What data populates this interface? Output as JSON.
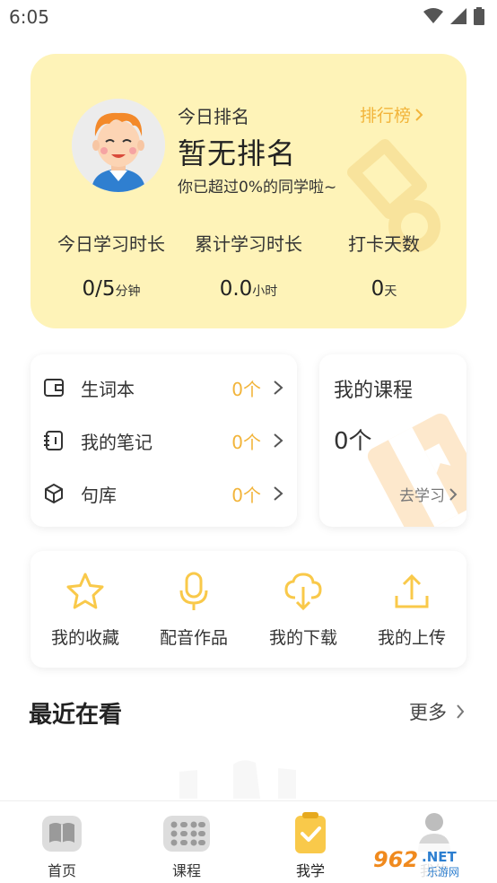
{
  "status_bar": {
    "time": "6:05"
  },
  "rank_card": {
    "label": "今日排名",
    "value": "暂无排名",
    "description": "你已超过0%的同学啦~",
    "leaderboard_link": "排行榜",
    "stats": [
      {
        "label": "今日学习时长",
        "value": "0/5",
        "unit": "分钟"
      },
      {
        "label": "累计学习时长",
        "value": "0.0",
        "unit": "小时"
      },
      {
        "label": "打卡天数",
        "value": "0",
        "unit": "天"
      }
    ]
  },
  "list_card": {
    "items": [
      {
        "label": "生词本",
        "count": "0个",
        "icon": "wallet-icon"
      },
      {
        "label": "我的笔记",
        "count": "0个",
        "icon": "notebook-icon"
      },
      {
        "label": "句库",
        "count": "0个",
        "icon": "cube-icon"
      }
    ]
  },
  "course_card": {
    "title": "我的课程",
    "count": "0个",
    "go_label": "去学习"
  },
  "actions": [
    {
      "label": "我的收藏",
      "icon": "star-icon"
    },
    {
      "label": "配音作品",
      "icon": "microphone-icon"
    },
    {
      "label": "我的下载",
      "icon": "cloud-download-icon"
    },
    {
      "label": "我的上传",
      "icon": "upload-icon"
    }
  ],
  "recent": {
    "title": "最近在看",
    "more_label": "更多"
  },
  "bottom_nav": {
    "items": [
      {
        "label": "首页",
        "icon": "book-icon",
        "active": false
      },
      {
        "label": "课程",
        "icon": "grid-icon",
        "active": false
      },
      {
        "label": "我学",
        "icon": "clipboard-check-icon",
        "active": true
      },
      {
        "label": "我的",
        "icon": "user-icon",
        "active": false
      }
    ]
  },
  "colors": {
    "accent": "#f9c94a",
    "card_bg": "#fef3b8",
    "link": "#f2b43a"
  },
  "watermark": {
    "text_main": "962",
    "text_net": ".NET",
    "text_sub": "乐游网"
  }
}
